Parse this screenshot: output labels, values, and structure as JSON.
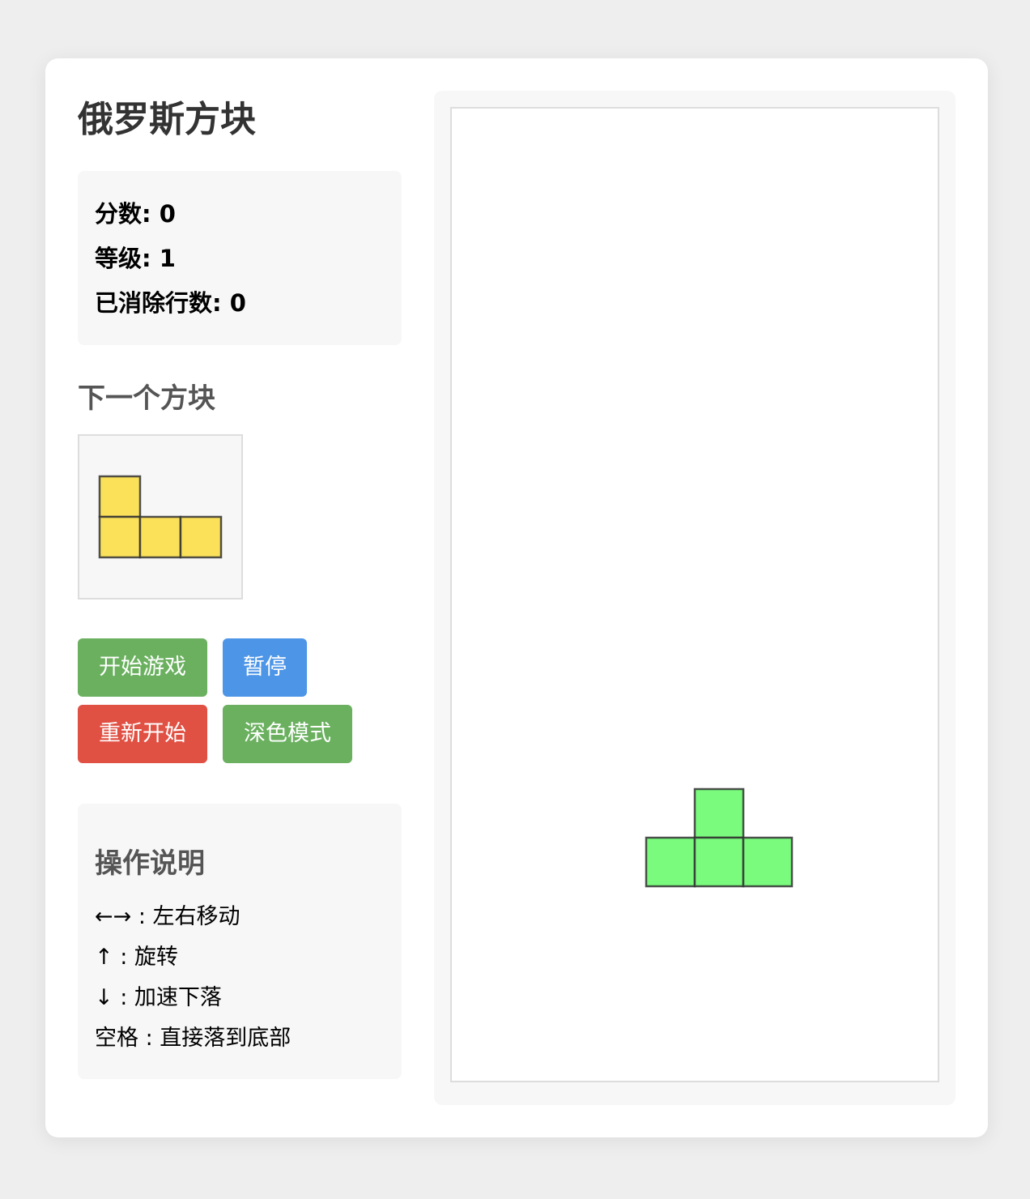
{
  "title": "俄罗斯方块",
  "stats": {
    "score_label": "分数: 0",
    "level_label": "等级: 1",
    "lines_label": "已消除行数: 0",
    "score": 0,
    "level": 1,
    "lines": 0
  },
  "next": {
    "title": "下一个方块",
    "piece": "J",
    "color": "#fbe15a",
    "cells": [
      [
        0,
        0
      ],
      [
        0,
        1
      ],
      [
        1,
        1
      ],
      [
        2,
        1
      ]
    ]
  },
  "buttons": {
    "start": "开始游戏",
    "pause": "暂停",
    "restart": "重新开始",
    "dark_mode": "深色模式"
  },
  "help": {
    "title": "操作说明",
    "lines": [
      "←→ : 左右移动",
      "↑ : 旋转",
      "↓ : 加速下落",
      "空格 : 直接落到底部"
    ]
  },
  "board": {
    "columns": 10,
    "rows": 20,
    "current_piece": "T",
    "current_color": "#7afb7e",
    "current_cells": [
      [
        5,
        14
      ],
      [
        4,
        15
      ],
      [
        5,
        15
      ],
      [
        6,
        15
      ]
    ]
  },
  "colors": {
    "start_button": "#6ab05f",
    "pause_button": "#4d95e7",
    "restart_button": "#e05043",
    "dark_mode_button": "#6ab05f"
  }
}
